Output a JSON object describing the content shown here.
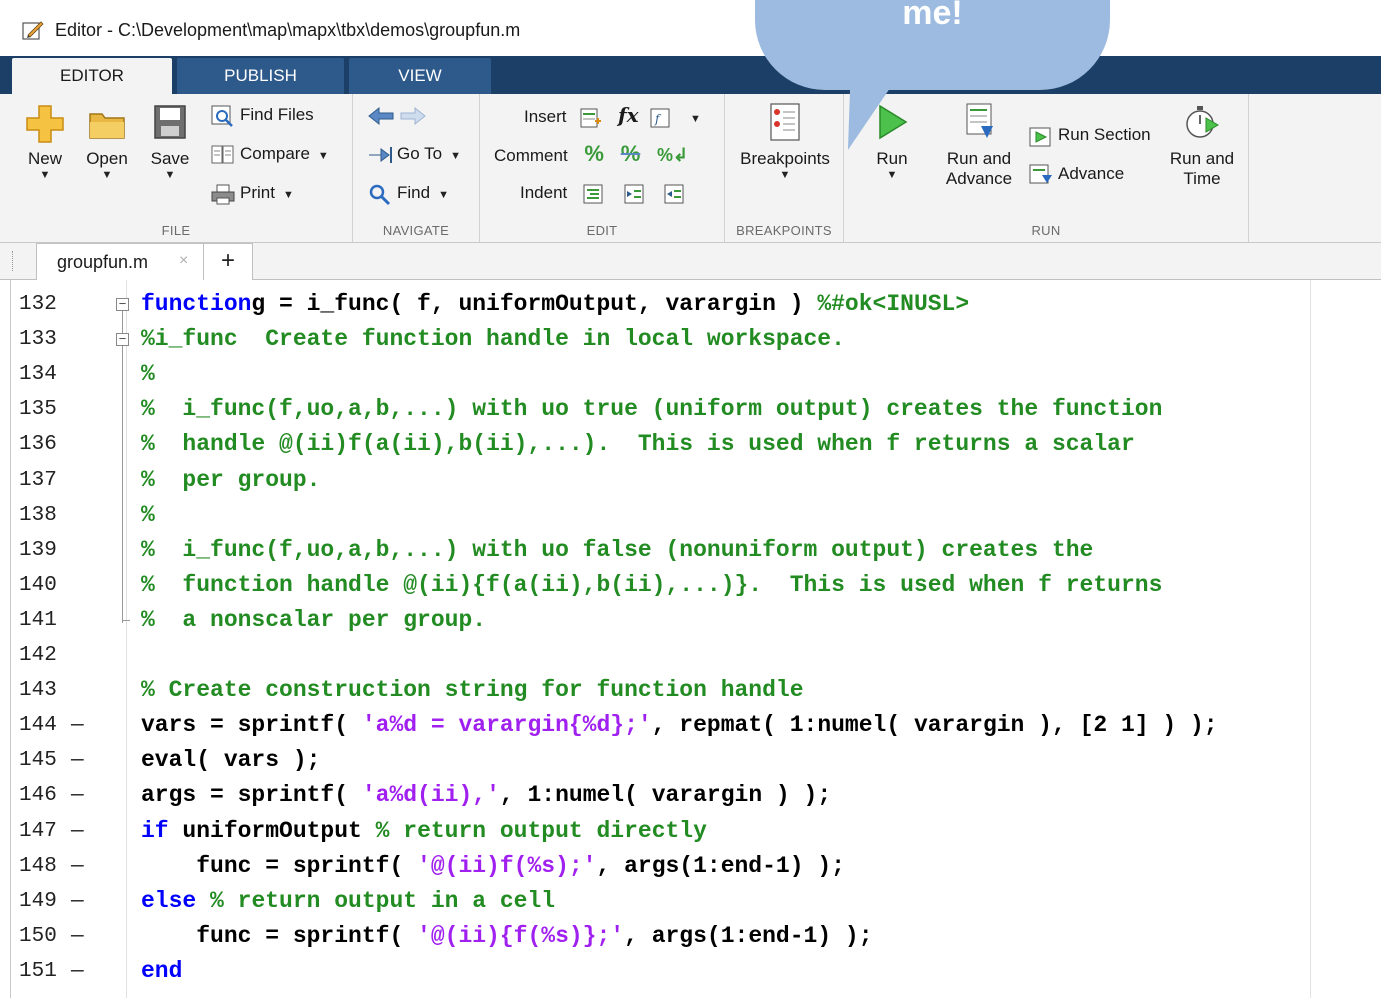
{
  "window": {
    "title": "Editor - C:\\Development\\map\\mapx\\tbx\\demos\\groupfun.m"
  },
  "callout": {
    "text": "me!"
  },
  "tabs": [
    {
      "label": "EDITOR",
      "active": true
    },
    {
      "label": "PUBLISH",
      "active": false
    },
    {
      "label": "VIEW",
      "active": false
    }
  ],
  "ribbon": {
    "file": {
      "label": "FILE",
      "new": "New",
      "open": "Open",
      "save": "Save",
      "find_files": "Find Files",
      "compare": "Compare",
      "print": "Print"
    },
    "navigate": {
      "label": "NAVIGATE",
      "go_to": "Go To",
      "find": "Find"
    },
    "edit": {
      "label": "EDIT",
      "insert": "Insert",
      "comment": "Comment",
      "indent": "Indent",
      "fx": "fx"
    },
    "breakpoints": {
      "label": "BREAKPOINTS",
      "breakpoints": "Breakpoints"
    },
    "run": {
      "label": "RUN",
      "run": "Run",
      "run_and_advance_1": "Run and",
      "run_and_advance_2": "Advance",
      "run_section": "Run Section",
      "advance": "Advance",
      "run_and_time_1": "Run and",
      "run_and_time_2": "Time"
    }
  },
  "document_tab": {
    "filename": "groupfun.m",
    "close": "×",
    "new_tab": "+"
  },
  "code_lines": [
    {
      "n": "132",
      "fold": "minus",
      "segs": [
        [
          "kw",
          "function"
        ],
        [
          "",
          "g = i_func( f, uniformOutput, varargin ) "
        ],
        [
          "cm",
          "%#ok<INUSL>"
        ]
      ]
    },
    {
      "n": "133",
      "fold": "minus",
      "segs": [
        [
          "cm",
          "%i_func  Create function handle in local workspace."
        ]
      ]
    },
    {
      "n": "134",
      "segs": [
        [
          "cm",
          "%"
        ]
      ]
    },
    {
      "n": "135",
      "segs": [
        [
          "cm",
          "%  i_func(f,uo,a,b,...) with uo true (uniform output) creates the function"
        ]
      ]
    },
    {
      "n": "136",
      "segs": [
        [
          "cm",
          "%  handle @(ii)f(a(ii),b(ii),...).  This is used when f returns a scalar"
        ]
      ]
    },
    {
      "n": "137",
      "segs": [
        [
          "cm",
          "%  per group."
        ]
      ]
    },
    {
      "n": "138",
      "segs": [
        [
          "cm",
          "%"
        ]
      ]
    },
    {
      "n": "139",
      "segs": [
        [
          "cm",
          "%  i_func(f,uo,a,b,...) with uo false (nonuniform output) creates the"
        ]
      ]
    },
    {
      "n": "140",
      "segs": [
        [
          "cm",
          "%  function handle @(ii){f(a(ii),b(ii),...)}.  This is used when f returns"
        ]
      ]
    },
    {
      "n": "141",
      "fold": "end",
      "segs": [
        [
          "cm",
          "%  a nonscalar per group."
        ]
      ]
    },
    {
      "n": "142",
      "segs": []
    },
    {
      "n": "143",
      "segs": [
        [
          "cm",
          "% Create construction string for function handle"
        ]
      ]
    },
    {
      "n": "144",
      "dash": true,
      "segs": [
        [
          "",
          "vars = sprintf( "
        ],
        [
          "st",
          "'a%d = varargin{%d};'"
        ],
        [
          "",
          ", repmat( 1:numel( varargin ), [2 1] ) );"
        ]
      ]
    },
    {
      "n": "145",
      "dash": true,
      "segs": [
        [
          "",
          "eval( vars );"
        ]
      ]
    },
    {
      "n": "146",
      "dash": true,
      "segs": [
        [
          "",
          "args = sprintf( "
        ],
        [
          "st",
          "'a%d(ii),'"
        ],
        [
          "",
          ", 1:numel( varargin ) );"
        ]
      ]
    },
    {
      "n": "147",
      "dash": true,
      "segs": [
        [
          "kw",
          "if"
        ],
        [
          "",
          " uniformOutput "
        ],
        [
          "cm",
          "% return output directly"
        ]
      ]
    },
    {
      "n": "148",
      "dash": true,
      "segs": [
        [
          "",
          "    func = sprintf( "
        ],
        [
          "st",
          "'@(ii)f(%s);'"
        ],
        [
          "",
          ", args(1:end-1) );"
        ]
      ]
    },
    {
      "n": "149",
      "dash": true,
      "segs": [
        [
          "kw",
          "else"
        ],
        [
          "",
          " "
        ],
        [
          "cm",
          "% return output in a cell"
        ]
      ]
    },
    {
      "n": "150",
      "dash": true,
      "segs": [
        [
          "",
          "    func = sprintf( "
        ],
        [
          "st",
          "'@(ii){f(%s)};'"
        ],
        [
          "",
          ", args(1:end-1) );"
        ]
      ]
    },
    {
      "n": "151",
      "dash": true,
      "segs": [
        [
          "kw",
          "end"
        ]
      ]
    }
  ]
}
